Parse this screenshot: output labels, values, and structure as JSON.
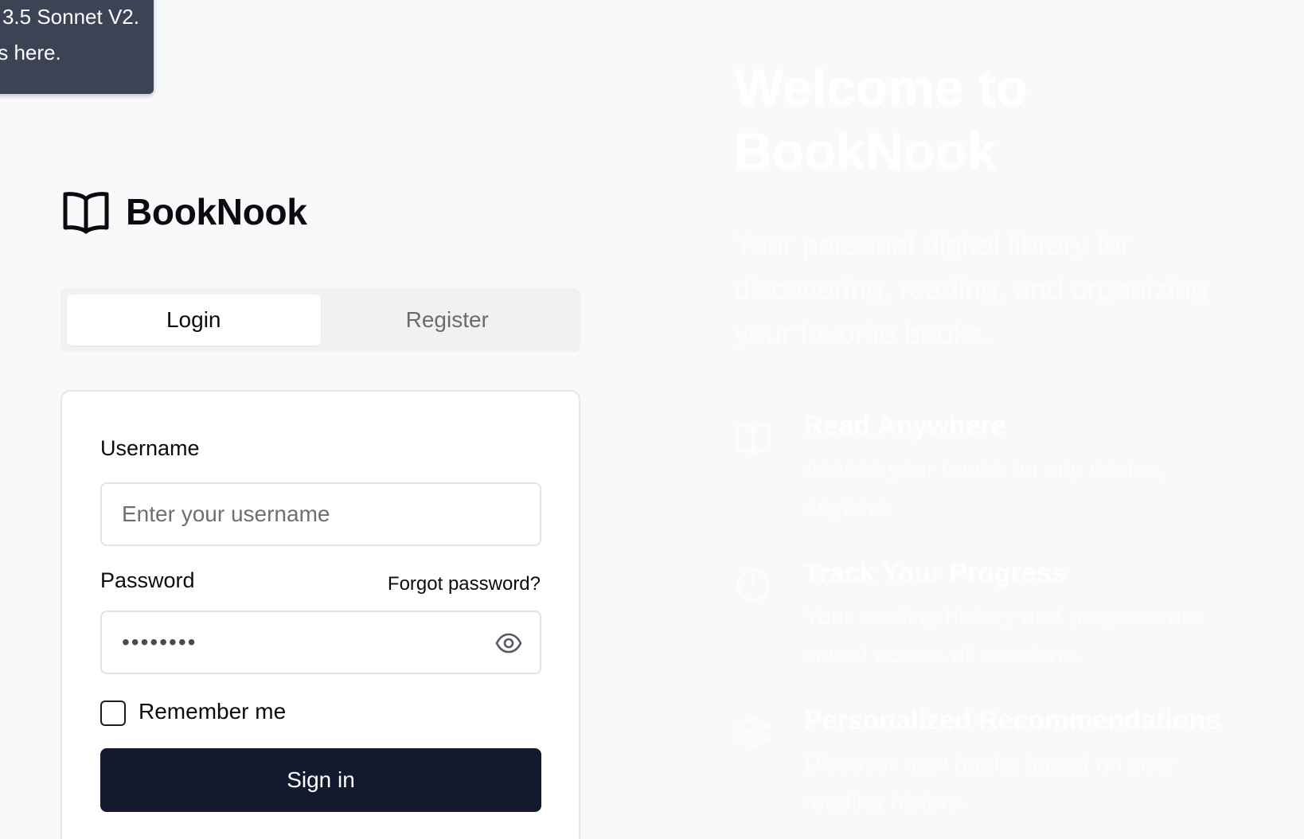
{
  "tooltip": {
    "line1": "3.5 Sonnet V2.",
    "line2": "ts here."
  },
  "logo": {
    "icon": "book-open-icon",
    "brand": "BookNook"
  },
  "tabs": [
    {
      "label": "Login",
      "active": true
    },
    {
      "label": "Register",
      "active": false
    }
  ],
  "form": {
    "username_label": "Username",
    "username_placeholder": "Enter your username",
    "password_label": "Password",
    "forgot_link": "Forgot password?",
    "password_value": "••••••••",
    "password_toggle_icon": "eye-icon",
    "remember_label": "Remember me",
    "remember_checked": false,
    "submit_label": "Sign in"
  },
  "hero": {
    "title": "Welcome to BookNook",
    "subtitle": "Your personal digital library for discovering, reading, and organizing your favorite books.",
    "features": [
      {
        "icon": "book-open-icon",
        "title": "Read Anywhere",
        "description": "Access your books on any device, anytime."
      },
      {
        "icon": "clock-icon",
        "title": "Track Your Progress",
        "description": "Your reading history and progress are saved across all sessions."
      },
      {
        "icon": "layers-icon",
        "title": "Personalized Recommendations",
        "description": "Discover new books based on your reading history."
      }
    ]
  },
  "colors": {
    "background": "#f8f9fb",
    "primary_button": "#141a2e",
    "tooltip": "#3c4354"
  }
}
